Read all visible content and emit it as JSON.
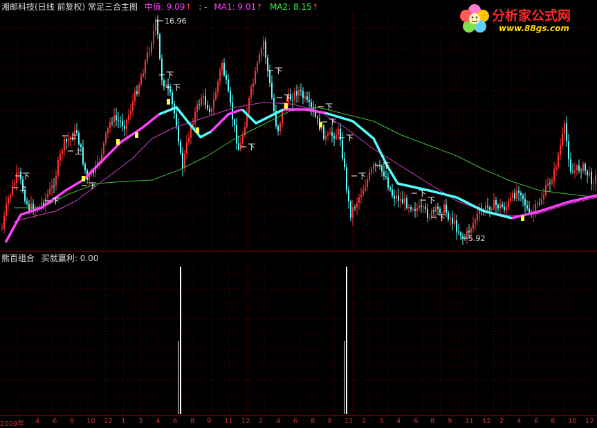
{
  "main_header": {
    "name": "湘邮科技(日线 前复权) 常足三合主图",
    "mid_label": "中值: 9.09",
    "mid_arrow": "↑",
    "extra": ": -",
    "ma1_label": "MA1: 9.01",
    "ma1_arrow": "↑",
    "ma2_label": "MA2: 8.15",
    "ma2_arrow": "↑"
  },
  "annotations": {
    "high": "16.96",
    "low": "5.92"
  },
  "sub_header": {
    "title": "熊百组合",
    "indicator": "买就赢利: 0.00"
  },
  "logo": {
    "title": "分析家公式网",
    "url": "www.88gs.com"
  },
  "markers": {
    "down": "下",
    "up": "上"
  },
  "x_axis": {
    "labels": [
      "2009年",
      "4",
      "6",
      "8",
      "10",
      "12",
      "1",
      "3",
      "4",
      "6",
      "8",
      "9",
      "11",
      "12",
      "2",
      "4",
      "6",
      "8",
      "9",
      "11",
      "1",
      "3",
      "4",
      "6",
      "8",
      "9",
      "11",
      "12",
      "2",
      "4",
      "6",
      "8",
      "10",
      "12"
    ]
  },
  "colors": {
    "background": "#000000",
    "grid": "#7a0000",
    "up_candle": "#ff3232",
    "down_candle": "#54ffff",
    "mid_line": "#ff40ff",
    "ma1_line": "#d040d0",
    "ma2_line": "#40c040",
    "header_white": "#d8d8d8",
    "header_mid": "#ff40ff",
    "header_ma2": "#40ff40"
  }
}
